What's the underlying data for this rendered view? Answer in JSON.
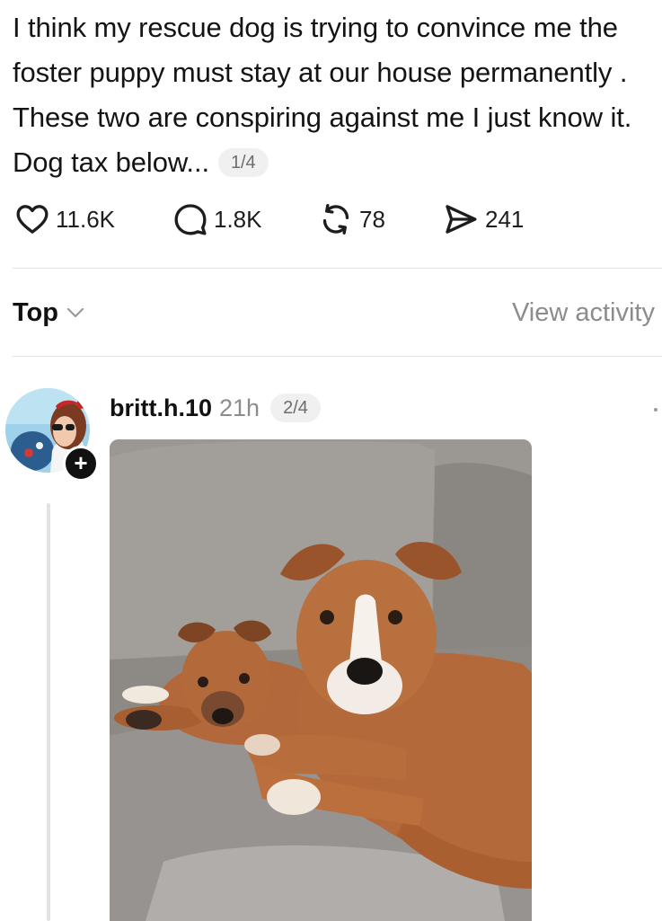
{
  "post": {
    "text": "I think my rescue dog is trying to convince me the foster puppy must stay at our house permanently . These two are conspiring against me I just know it. Dog tax below...",
    "page_indicator": "1/4"
  },
  "actions": {
    "likes": "11.6K",
    "comments": "1.8K",
    "reposts": "78",
    "shares": "241"
  },
  "sort": {
    "label": "Top",
    "view_activity": "View activity"
  },
  "reply": {
    "username": "britt.h.10",
    "time": "21h",
    "page_indicator": "2/4"
  },
  "icons": {
    "like": "heart-icon",
    "comment": "speech-bubble-icon",
    "repost": "repost-icon",
    "share": "send-icon",
    "sort": "chevron-down-icon",
    "follow": "plus-icon",
    "more": "more-dots-icon"
  }
}
